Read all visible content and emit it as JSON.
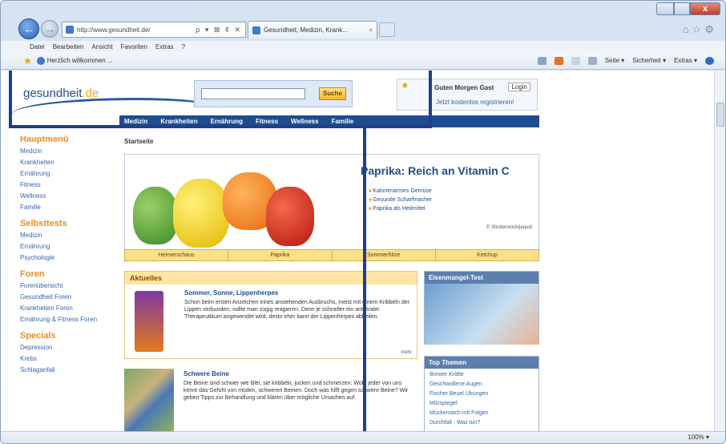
{
  "browser": {
    "url": "http://www.gesundheit.de/",
    "address_controls": "ρ ▾ ⊠ ¢ ✕",
    "tab_title": "Gesundheit, Medizin, Krank...",
    "tab_close": "×",
    "menu": [
      "Datei",
      "Bearbeiten",
      "Ansicht",
      "Favoriten",
      "Extras",
      "?"
    ],
    "favorite_tab": "Herzlich willkommen ...",
    "commands": [
      "Seite ▾",
      "Sicherheit ▾",
      "Extras ▾"
    ],
    "zoom": "100%",
    "close_glyph": "x"
  },
  "site": {
    "logo_main": "gesundheit",
    "logo_tld": ".de",
    "search_button": "Suche",
    "greeting": "Guten Morgen Gast",
    "login_button": "Login",
    "register": "Jetzt kostenlos registrieren!",
    "nav": [
      "Medizin",
      "Krankheiten",
      "Ernährung",
      "Fitness",
      "Wellness",
      "Familie"
    ]
  },
  "sidebar": {
    "sections": [
      {
        "title": "Hauptmenü",
        "items": [
          "Medizin",
          "Krankheiten",
          "Ernährung",
          "Fitness",
          "Wellness",
          "Familie"
        ]
      },
      {
        "title": "Selbsttests",
        "items": [
          "Medizin",
          "Ernährung",
          "Psychologie"
        ]
      },
      {
        "title": "Foren",
        "items": [
          "Forenübersicht",
          "Gesundheit Foren",
          "Krankheiten Foren",
          "Ernährung & Fitness Foren"
        ]
      },
      {
        "title": "Specials",
        "items": [
          "Depression",
          "Krebs",
          "Schlaganfall"
        ]
      }
    ]
  },
  "main": {
    "breadcrumb": "Startseite",
    "hero_title": "Paprika: Reich an Vitamin C",
    "hero_bullets": [
      "Kalorienarmes Gemüse",
      "Gesunde Scharfmacher",
      "Paprika als Heilmittel"
    ],
    "hero_credit": "© Shutterstock/jaqudi",
    "hero_tabs": [
      "Heimerschaus",
      "Paprika",
      "Sommerhitze",
      "Ketchup"
    ],
    "aktuelles_title": "Aktuelles",
    "article1_title": "Sommer, Sonne, Lippenherpes",
    "article1_text": "Schon beim ersten Anzeichen eines anstehenden Ausbruchs, meist mit einem Kribbeln der Lippen verbunden, sollte man zügig reagieren. Denn je schneller ein antiviraler Therapeutikum angewendet wird, desto eher kann der Lippenherpes abheilen.",
    "article1_more": "mehr",
    "article2_title": "Schwere Beine",
    "article2_text": "Die Beine sind schwer wie Blei, sie kribbeln, jucken und schmerzen: Wohl jeder von uns kennt das Gefühl von müden, schweren Beinen. Doch was hilft gegen schwere Beine? Wir geben Tipps zur Behandlung und klären über mögliche Ursachen auf."
  },
  "right": {
    "test_title": "Eisenmangel-Test",
    "top_title": "Top Themen",
    "top_items": [
      "Brewer Kräfte",
      "Geschwollene Augen",
      "Fischer Beuel Übungen",
      "Milzspiegel",
      "Mückenstich mit Folgen",
      "Durchfall - Was tun?"
    ]
  }
}
